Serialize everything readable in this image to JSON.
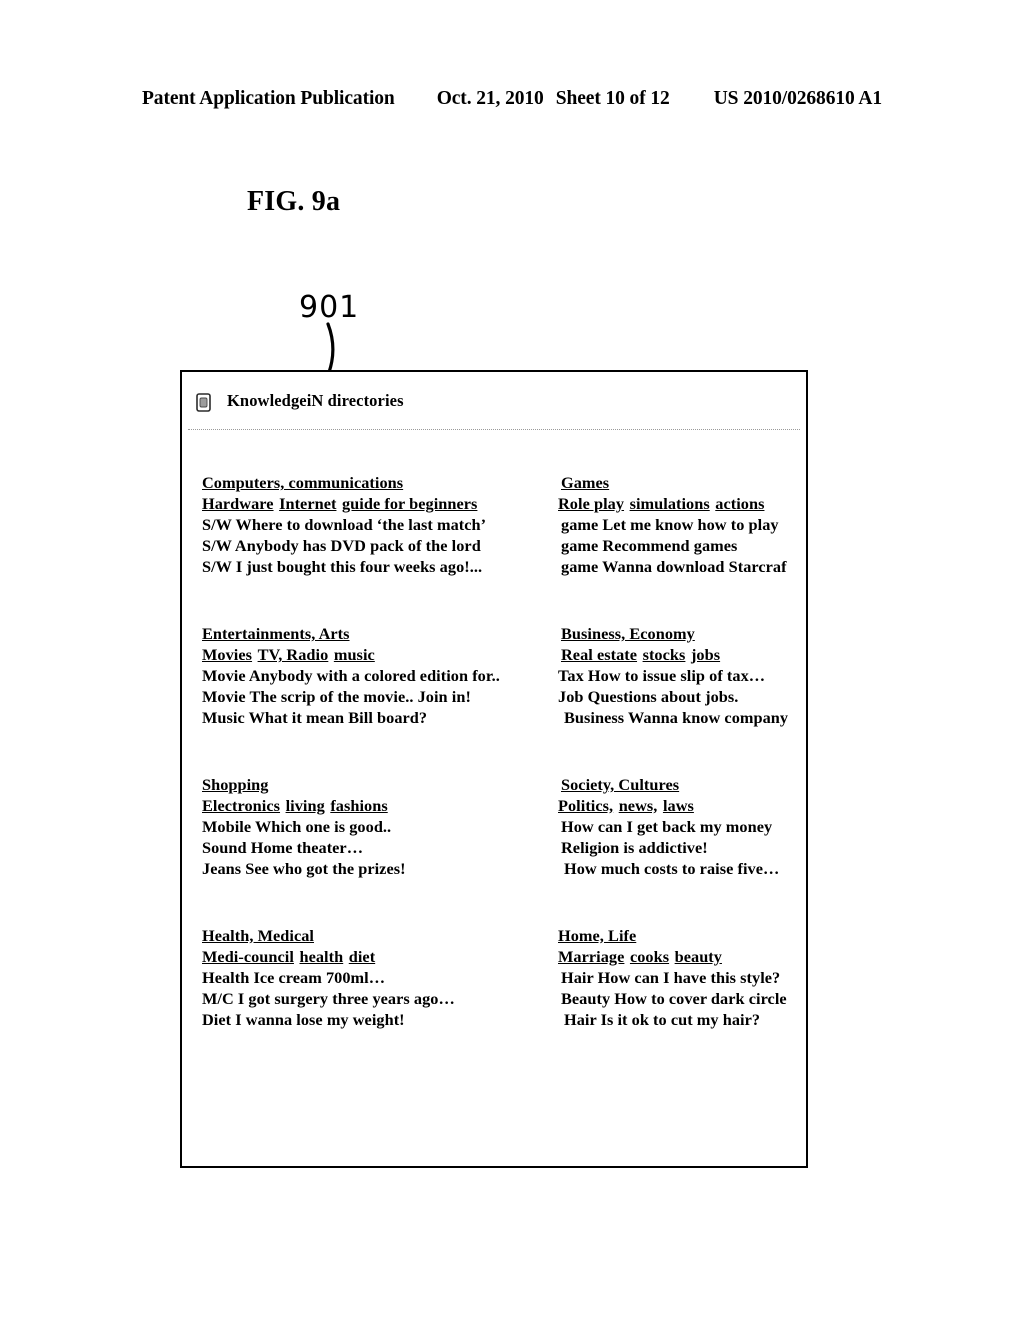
{
  "page_header": {
    "publication": "Patent Application Publication",
    "date": "Oct. 21, 2010",
    "sheet": "Sheet 10 of 12",
    "serial": "US 2010/0268610 A1"
  },
  "figure": {
    "label": "FIG. 9a",
    "reference_numeral": "901"
  },
  "panel": {
    "icon": "document-icon",
    "title": "KnowledgeiN directories",
    "blocks": [
      {
        "id": "computers-communications",
        "category": "Computers, communications",
        "subcategories": [
          "Hardware",
          "Internet",
          "guide for beginners"
        ],
        "items": [
          "S/W Where to download ‘the last match’",
          "S/W Anybody has DVD pack of the lord",
          "S/W I just bought this four weeks ago!..."
        ]
      },
      {
        "id": "games",
        "category": "Games",
        "subcategories": [
          "Role play",
          "simulations",
          "actions"
        ],
        "items": [
          "game Let me know how to play",
          "game Recommend games",
          "game Wanna  download Starcraf"
        ]
      },
      {
        "id": "entertainments-arts",
        "category": "Entertainments, Arts",
        "subcategories": [
          "Movies",
          "TV, Radio",
          "music"
        ],
        "items": [
          "Movie Anybody with a colored edition for..",
          "Movie The scrip of the movie.. Join in!",
          "Music What it mean Bill board?"
        ]
      },
      {
        "id": "business-economy",
        "category": "Business, Economy",
        "subcategories": [
          "Real estate",
          "stocks",
          "jobs"
        ],
        "items": [
          "Tax How to issue slip of tax…",
          "Job Questions about jobs.",
          "Business Wanna know company"
        ]
      },
      {
        "id": "shopping",
        "category": "Shopping",
        "subcategories": [
          "Electronics",
          "living",
          "fashions"
        ],
        "items": [
          "Mobile Which one is good..",
          "Sound Home theater…",
          "Jeans See who got the prizes!"
        ]
      },
      {
        "id": "society-cultures",
        "category": "Society, Cultures",
        "subcategories": [
          "Politics,",
          "news,",
          "laws"
        ],
        "items": [
          "How can I get back my money",
          "Religion is addictive!",
          "How much costs to raise five…"
        ]
      },
      {
        "id": "health-medical",
        "category": "Health, Medical",
        "subcategories": [
          "Medi-council",
          "health",
          "diet"
        ],
        "items": [
          "Health Ice cream 700ml…",
          "M/C I got surgery three years ago…",
          "Diet I wanna lose my weight!"
        ]
      },
      {
        "id": "home-life",
        "category": "Home, Life",
        "subcategories": [
          "Marriage",
          "cooks",
          "beauty"
        ],
        "items": [
          "Hair How can I have this style?",
          "Beauty How to cover dark circle",
          "Hair Is it ok to cut my hair?"
        ]
      }
    ]
  }
}
